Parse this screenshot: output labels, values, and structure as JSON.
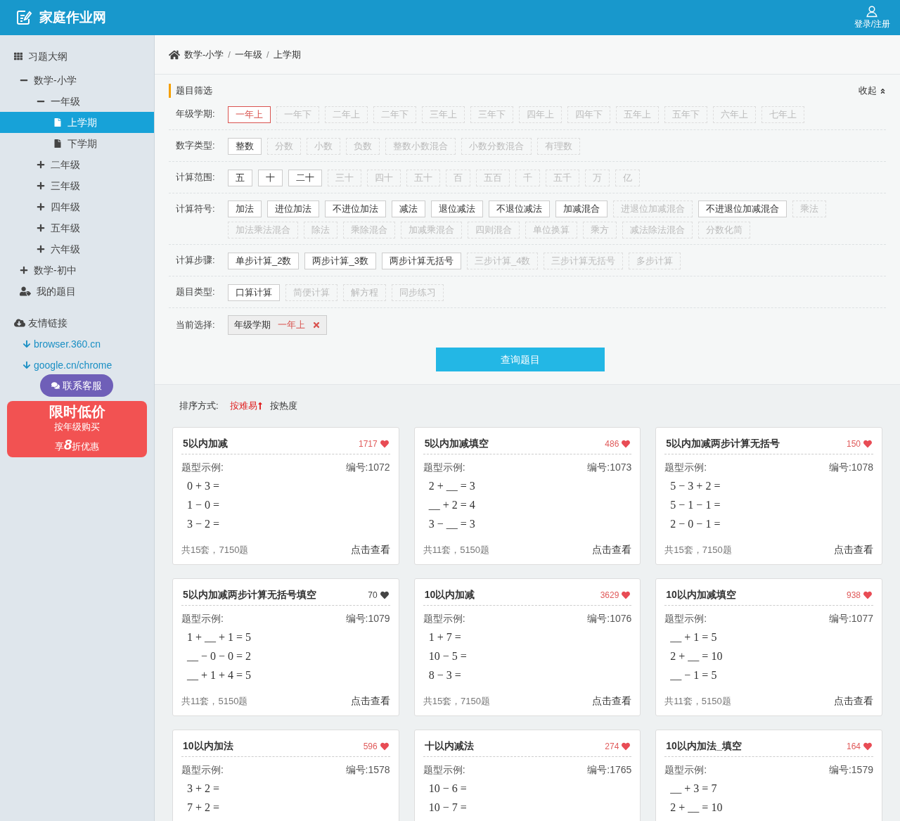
{
  "header": {
    "logo": "家庭作业网",
    "login": "登录/注册"
  },
  "sidebar": {
    "title": "习题大纲",
    "tree": [
      {
        "label": "数学-小学",
        "kind": "folder",
        "expanded": true,
        "selected": false,
        "children": [
          {
            "label": "一年级",
            "kind": "folder",
            "expanded": true,
            "selected": false,
            "children": [
              {
                "label": "上学期",
                "kind": "page",
                "selected": true
              },
              {
                "label": "下学期",
                "kind": "page",
                "selected": false
              }
            ]
          },
          {
            "label": "二年级",
            "kind": "folder",
            "expanded": false,
            "selected": false
          },
          {
            "label": "三年级",
            "kind": "folder",
            "expanded": false,
            "selected": false
          },
          {
            "label": "四年级",
            "kind": "folder",
            "expanded": false,
            "selected": false
          },
          {
            "label": "五年级",
            "kind": "folder",
            "expanded": false,
            "selected": false
          },
          {
            "label": "六年级",
            "kind": "folder",
            "expanded": false,
            "selected": false
          }
        ]
      },
      {
        "label": "数学-初中",
        "kind": "folder",
        "expanded": false,
        "selected": false
      },
      {
        "label": "我的题目",
        "kind": "user",
        "selected": false
      }
    ],
    "links_title": "友情链接",
    "links": [
      "browser.360.cn",
      "google.cn/chrome"
    ],
    "service": "联系客服",
    "promo": {
      "title": "限时低价",
      "line": "按年级购买",
      "discount_prefix": "享",
      "discount_num": "8",
      "discount_suffix": "折优惠"
    }
  },
  "breadcrumb": {
    "separator": "/",
    "items": [
      "数学-小学",
      "一年级",
      "上学期"
    ]
  },
  "filter": {
    "title": "题目筛选",
    "collapse": "收起",
    "groups": [
      {
        "label": "年级学期:",
        "options": [
          {
            "text": "一年上",
            "selected": true,
            "disabled": false
          },
          {
            "text": "一年下",
            "selected": false,
            "disabled": true
          },
          {
            "text": "二年上",
            "selected": false,
            "disabled": true
          },
          {
            "text": "二年下",
            "selected": false,
            "disabled": true
          },
          {
            "text": "三年上",
            "selected": false,
            "disabled": true
          },
          {
            "text": "三年下",
            "selected": false,
            "disabled": true
          },
          {
            "text": "四年上",
            "selected": false,
            "disabled": true
          },
          {
            "text": "四年下",
            "selected": false,
            "disabled": true
          },
          {
            "text": "五年上",
            "selected": false,
            "disabled": true
          },
          {
            "text": "五年下",
            "selected": false,
            "disabled": true
          },
          {
            "text": "六年上",
            "selected": false,
            "disabled": true
          },
          {
            "text": "七年上",
            "selected": false,
            "disabled": true
          }
        ]
      },
      {
        "label": "数字类型:",
        "options": [
          {
            "text": "整数",
            "selected": false,
            "disabled": false
          },
          {
            "text": "分数",
            "selected": false,
            "disabled": true
          },
          {
            "text": "小数",
            "selected": false,
            "disabled": true
          },
          {
            "text": "负数",
            "selected": false,
            "disabled": true
          },
          {
            "text": "整数小数混合",
            "selected": false,
            "disabled": true
          },
          {
            "text": "小数分数混合",
            "selected": false,
            "disabled": true
          },
          {
            "text": "有理数",
            "selected": false,
            "disabled": true
          }
        ]
      },
      {
        "label": "计算范围:",
        "options": [
          {
            "text": "五",
            "selected": false,
            "disabled": false
          },
          {
            "text": "十",
            "selected": false,
            "disabled": false
          },
          {
            "text": "二十",
            "selected": false,
            "disabled": false
          },
          {
            "text": "三十",
            "selected": false,
            "disabled": true
          },
          {
            "text": "四十",
            "selected": false,
            "disabled": true
          },
          {
            "text": "五十",
            "selected": false,
            "disabled": true
          },
          {
            "text": "百",
            "selected": false,
            "disabled": true
          },
          {
            "text": "五百",
            "selected": false,
            "disabled": true
          },
          {
            "text": "千",
            "selected": false,
            "disabled": true
          },
          {
            "text": "五千",
            "selected": false,
            "disabled": true
          },
          {
            "text": "万",
            "selected": false,
            "disabled": true
          },
          {
            "text": "亿",
            "selected": false,
            "disabled": true
          }
        ]
      },
      {
        "label": "计算符号:",
        "options": [
          {
            "text": "加法",
            "selected": false,
            "disabled": false
          },
          {
            "text": "进位加法",
            "selected": false,
            "disabled": false
          },
          {
            "text": "不进位加法",
            "selected": false,
            "disabled": false
          },
          {
            "text": "减法",
            "selected": false,
            "disabled": false
          },
          {
            "text": "退位减法",
            "selected": false,
            "disabled": false
          },
          {
            "text": "不退位减法",
            "selected": false,
            "disabled": false
          },
          {
            "text": "加减混合",
            "selected": false,
            "disabled": false
          },
          {
            "text": "进退位加减混合",
            "selected": false,
            "disabled": true
          },
          {
            "text": "不进退位加减混合",
            "selected": false,
            "disabled": false
          },
          {
            "text": "乘法",
            "selected": false,
            "disabled": true
          },
          {
            "text": "加法乘法混合",
            "selected": false,
            "disabled": true
          },
          {
            "text": "除法",
            "selected": false,
            "disabled": true
          },
          {
            "text": "乘除混合",
            "selected": false,
            "disabled": true
          },
          {
            "text": "加减乘混合",
            "selected": false,
            "disabled": true
          },
          {
            "text": "四则混合",
            "selected": false,
            "disabled": true
          },
          {
            "text": "单位换算",
            "selected": false,
            "disabled": true
          },
          {
            "text": "乘方",
            "selected": false,
            "disabled": true
          },
          {
            "text": "减法除法混合",
            "selected": false,
            "disabled": true
          },
          {
            "text": "分数化简",
            "selected": false,
            "disabled": true
          }
        ]
      },
      {
        "label": "计算步骤:",
        "options": [
          {
            "text": "单步计算_2数",
            "selected": false,
            "disabled": false
          },
          {
            "text": "两步计算_3数",
            "selected": false,
            "disabled": false
          },
          {
            "text": "两步计算无括号",
            "selected": false,
            "disabled": false
          },
          {
            "text": "三步计算_4数",
            "selected": false,
            "disabled": true
          },
          {
            "text": "三步计算无括号",
            "selected": false,
            "disabled": true
          },
          {
            "text": "多步计算",
            "selected": false,
            "disabled": true
          }
        ]
      },
      {
        "label": "题目类型:",
        "options": [
          {
            "text": "口算计算",
            "selected": false,
            "disabled": false
          },
          {
            "text": "简便计算",
            "selected": false,
            "disabled": true
          },
          {
            "text": "解方程",
            "selected": false,
            "disabled": true
          },
          {
            "text": "同步练习",
            "selected": false,
            "disabled": true
          }
        ]
      }
    ],
    "current": {
      "label": "当前选择:",
      "name": "年级学期",
      "value": "一年上"
    },
    "query": "查询题目"
  },
  "sort": {
    "label": "排序方式:",
    "options": [
      {
        "text": "按难易",
        "selected": true
      },
      {
        "text": "按热度",
        "selected": false
      }
    ]
  },
  "cards": [
    {
      "title": "5以内加减",
      "count": "1717",
      "liked": true,
      "example_label": "题型示例:",
      "code": "编号:1072",
      "examples": [
        "0 + 3 =",
        "1 − 0 =",
        "3 − 2 ="
      ],
      "summary": "共15套，7150题",
      "action": "点击查看"
    },
    {
      "title": "5以内加减填空",
      "count": "486",
      "liked": true,
      "example_label": "题型示例:",
      "code": "编号:1073",
      "examples": [
        "2 + __ = 3",
        "__ + 2 = 4",
        "3 − __ = 3"
      ],
      "summary": "共11套，5150题",
      "action": "点击查看"
    },
    {
      "title": "5以内加减两步计算无括号",
      "count": "150",
      "liked": true,
      "example_label": "题型示例:",
      "code": "编号:1078",
      "examples": [
        "5 − 3 + 2 =",
        "5 − 1 − 1 =",
        "2 − 0 − 1 ="
      ],
      "summary": "共15套，7150题",
      "action": "点击查看"
    },
    {
      "title": "5以内加减两步计算无括号填空",
      "count": "70",
      "liked": false,
      "example_label": "题型示例:",
      "code": "编号:1079",
      "examples": [
        "1 + __ + 1 = 5",
        "__ − 0 − 0 = 2",
        "__ + 1 + 4 = 5"
      ],
      "summary": "共11套，5150题",
      "action": "点击查看"
    },
    {
      "title": "10以内加减",
      "count": "3629",
      "liked": true,
      "example_label": "题型示例:",
      "code": "编号:1076",
      "examples": [
        "1 + 7 =",
        "10 − 5 =",
        "8 − 3 ="
      ],
      "summary": "共15套，7150题",
      "action": "点击查看"
    },
    {
      "title": "10以内加减填空",
      "count": "938",
      "liked": true,
      "example_label": "题型示例:",
      "code": "编号:1077",
      "examples": [
        "__ + 1 = 5",
        "2 + __ = 10",
        "__ − 1 = 5"
      ],
      "summary": "共11套，5150题",
      "action": "点击查看"
    },
    {
      "title": "10以内加法",
      "count": "596",
      "liked": true,
      "example_label": "题型示例:",
      "code": "编号:1578",
      "examples": [
        "3 + 2 =",
        "7 + 2 ="
      ]
    },
    {
      "title": "十以内减法",
      "count": "274",
      "liked": true,
      "example_label": "题型示例:",
      "code": "编号:1765",
      "examples": [
        "10 − 6 =",
        "10 − 7 ="
      ]
    },
    {
      "title": "10以内加法_填空",
      "count": "164",
      "liked": true,
      "example_label": "题型示例:",
      "code": "编号:1579",
      "examples": [
        "__ + 3 = 7",
        "2 + __ = 10"
      ]
    }
  ]
}
